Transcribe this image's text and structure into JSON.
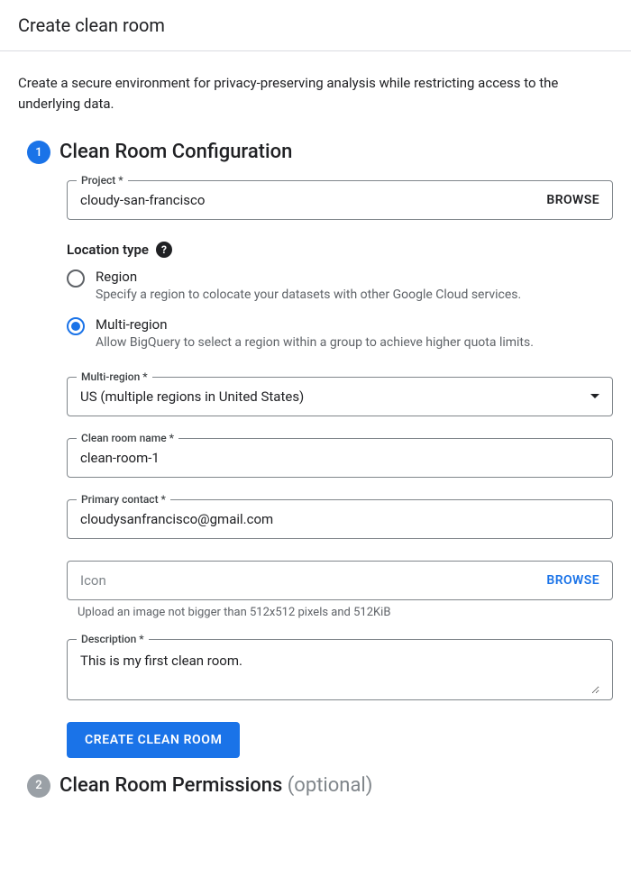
{
  "header": {
    "title": "Create clean room"
  },
  "intro": "Create a secure environment for privacy-preserving analysis while restricting access to the underlying data.",
  "steps": {
    "config": {
      "number": "1",
      "title": "Clean Room Configuration",
      "project": {
        "label": "Project *",
        "value": "cloudy-san-francisco",
        "browse": "BROWSE"
      },
      "location_type": {
        "label": "Location type",
        "options": {
          "region": {
            "label": "Region",
            "hint": "Specify a region to colocate your datasets with other Google Cloud services."
          },
          "multi": {
            "label": "Multi-region",
            "hint": "Allow BigQuery to select a region within a group to achieve higher quota limits."
          }
        },
        "selected": "multi"
      },
      "multi_region": {
        "label": "Multi-region *",
        "value": "US (multiple regions in United States)"
      },
      "clean_room_name": {
        "label": "Clean room name *",
        "value": "clean-room-1"
      },
      "primary_contact": {
        "label": "Primary contact *",
        "value": "cloudysanfrancisco@gmail.com"
      },
      "icon": {
        "placeholder": "Icon",
        "browse": "BROWSE",
        "hint": "Upload an image not bigger than 512x512 pixels and 512KiB"
      },
      "description": {
        "label": "Description *",
        "value": "This is my first clean room."
      },
      "submit": "CREATE CLEAN ROOM"
    },
    "permissions": {
      "number": "2",
      "title": "Clean Room Permissions ",
      "optional": "(optional)"
    }
  }
}
